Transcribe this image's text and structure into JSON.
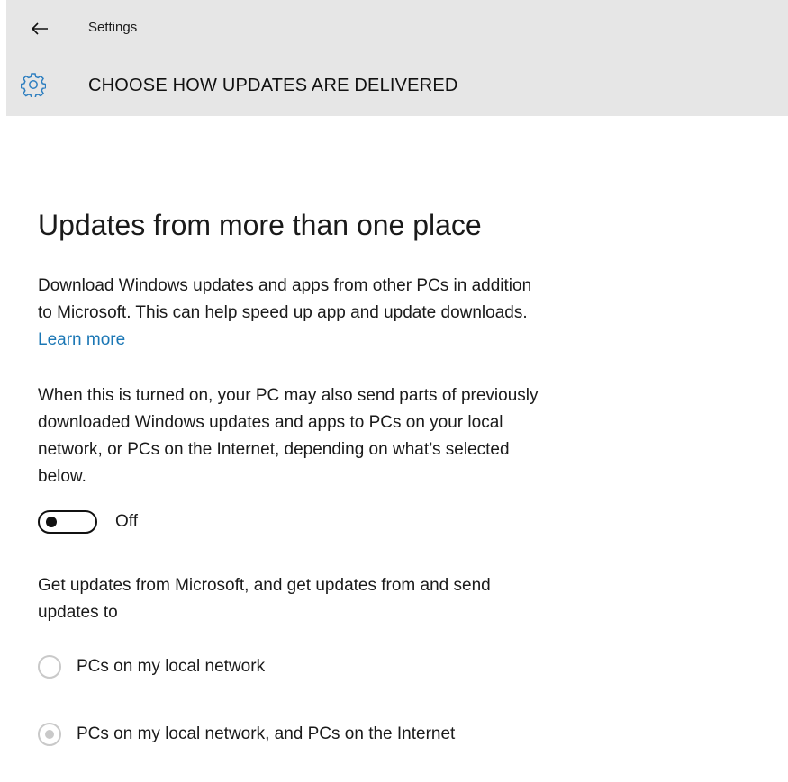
{
  "header": {
    "app_title": "Settings",
    "page_title": "CHOOSE HOW UPDATES ARE DELIVERED",
    "back_icon": "back-arrow-icon",
    "gear_icon": "gear-icon",
    "gear_color": "#2e7fc0"
  },
  "section": {
    "heading": "Updates from more than one place",
    "description_line1": "Download Windows updates and apps from other PCs in addition",
    "description_line2": "to Microsoft. This can help speed up app and update downloads.",
    "learn_more": "Learn more",
    "explanation_line1": "When this is turned on, your PC may also send parts of previously",
    "explanation_line2": "downloaded Windows updates and apps to PCs on your local",
    "explanation_line3": "network, or PCs on the Internet, depending on what’s selected",
    "explanation_line4": "below.",
    "toggle_state": "Off",
    "options_prompt_line1": "Get updates from Microsoft, and get updates from and send",
    "options_prompt_line2": "updates to",
    "options": [
      {
        "label": "PCs on my local network",
        "selected": false
      },
      {
        "label": "PCs on my local network, and PCs on the Internet",
        "selected": true
      }
    ]
  },
  "colors": {
    "header_bg": "#e6e6e6",
    "link": "#1b77b5",
    "disabled_radio": "#c9c9c9"
  }
}
